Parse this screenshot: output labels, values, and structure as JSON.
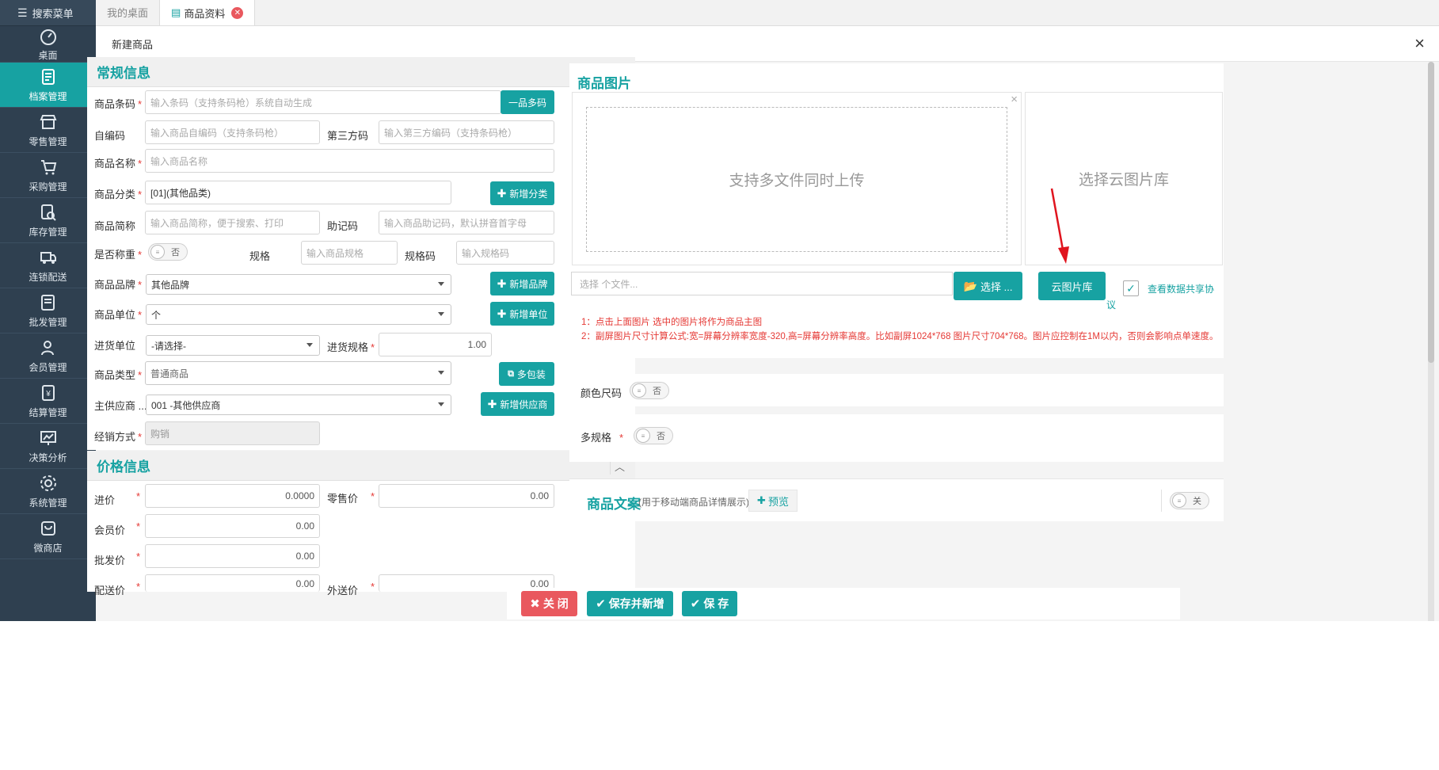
{
  "sidebar": {
    "search_label": "搜索菜单",
    "items": [
      {
        "label": "桌面",
        "icon": "dashboard-icon"
      },
      {
        "label": "档案管理",
        "icon": "archive-icon"
      },
      {
        "label": "零售管理",
        "icon": "store-icon"
      },
      {
        "label": "采购管理",
        "icon": "cart-icon"
      },
      {
        "label": "库存管理",
        "icon": "inventory-icon"
      },
      {
        "label": "连锁配送",
        "icon": "delivery-icon"
      },
      {
        "label": "批发管理",
        "icon": "wholesale-icon"
      },
      {
        "label": "会员管理",
        "icon": "member-icon"
      },
      {
        "label": "结算管理",
        "icon": "settlement-icon"
      },
      {
        "label": "决策分析",
        "icon": "chart-icon"
      },
      {
        "label": "系统管理",
        "icon": "gear-icon"
      },
      {
        "label": "微商店",
        "icon": "shop-icon"
      }
    ],
    "active_index": 1
  },
  "tabs": [
    {
      "label": "我的桌面"
    },
    {
      "label": "商品资料"
    }
  ],
  "dialog": {
    "title": "新建商品",
    "close": "×"
  },
  "general": {
    "title": "常规信息",
    "barcode_label": "商品条码",
    "barcode_placeholder": "输入条码（支持条码枪）系统自动生成",
    "multi_barcode_btn": "一品多码",
    "selfcode_label": "自编码",
    "selfcode_placeholder": "输入商品自编码（支持条码枪）",
    "thirdcode_label": "第三方码",
    "thirdcode_placeholder": "输入第三方编码（支持条码枪）",
    "name_label": "商品名称",
    "name_placeholder": "输入商品名称",
    "category_label": "商品分类",
    "category_value": "[01](其他品类)",
    "add_category_btn": "新增分类",
    "shortname_label": "商品简称",
    "shortname_placeholder": "输入商品简称，便于搜索、打印",
    "mnemonic_label": "助记码",
    "mnemonic_placeholder": "输入商品助记码，默认拼音首字母",
    "weigh_label": "是否称重",
    "weigh_toggle": "否",
    "spec_label": "规格",
    "spec_placeholder": "输入商品规格",
    "speccode_label": "规格码",
    "speccode_placeholder": "输入规格码",
    "brand_label": "商品品牌",
    "brand_value": "其他品牌",
    "add_brand_btn": "新增品牌",
    "unit_label": "商品单位",
    "unit_value": "个",
    "add_unit_btn": "新增单位",
    "purchase_unit_label": "进货单位",
    "purchase_unit_value": "-请选择-",
    "purchase_spec_label": "进货规格",
    "purchase_spec_value": "1.00",
    "type_label": "商品类型",
    "type_value": "普通商品",
    "multi_pack_btn": "多包装",
    "supplier_label": "主供应商 ...",
    "supplier_value": "001 -其他供应商",
    "add_supplier_btn": "新增供应商",
    "sales_mode_label": "经销方式",
    "sales_mode_value": "购销"
  },
  "price": {
    "title": "价格信息",
    "cost_label": "进价",
    "cost_value": "0.0000",
    "retail_label": "零售价",
    "retail_value": "0.00",
    "member_label": "会员价",
    "member_value": "0.00",
    "wholesale_label": "批发价",
    "wholesale_value": "0.00",
    "delivery_label": "配送价",
    "delivery_value": "0.00",
    "external_label": "外送价",
    "external_value": "0.00"
  },
  "images": {
    "title": "商品图片",
    "upload_text": "支持多文件同时上传",
    "upload_close": "×",
    "cloud_text": "选择云图片库",
    "file_placeholder": "选择 个文件...",
    "choose_btn": "选择 ...",
    "cloud_btn": "云图片库",
    "share_link": "查看数据共享协",
    "share_link_tail": "议",
    "note1": "1：点击上面图片 选中的图片将作为商品主图",
    "note2": "2：副屏图片尺寸计算公式:宽=屏幕分辨率宽度-320,高=屏幕分辨率高度。比如副屏1024*768 图片尺寸704*768。图片应控制在1M以内，否则会影响点单速度。"
  },
  "color_size": {
    "label": "颜色尺码",
    "toggle": "否"
  },
  "multi_spec": {
    "label": "多规格",
    "toggle": "否"
  },
  "copywriting": {
    "title": "商品文案",
    "subtitle": "(用于移动端商品详情展示)",
    "preview": "预览",
    "toggle": "关"
  },
  "footer": {
    "close_btn": "关 闭",
    "save_new_btn": "保存并新增",
    "save_btn": "保 存"
  },
  "colors": {
    "accent": "#17a2a2",
    "danger": "#e9585e",
    "sidebar": "#2f4050"
  }
}
